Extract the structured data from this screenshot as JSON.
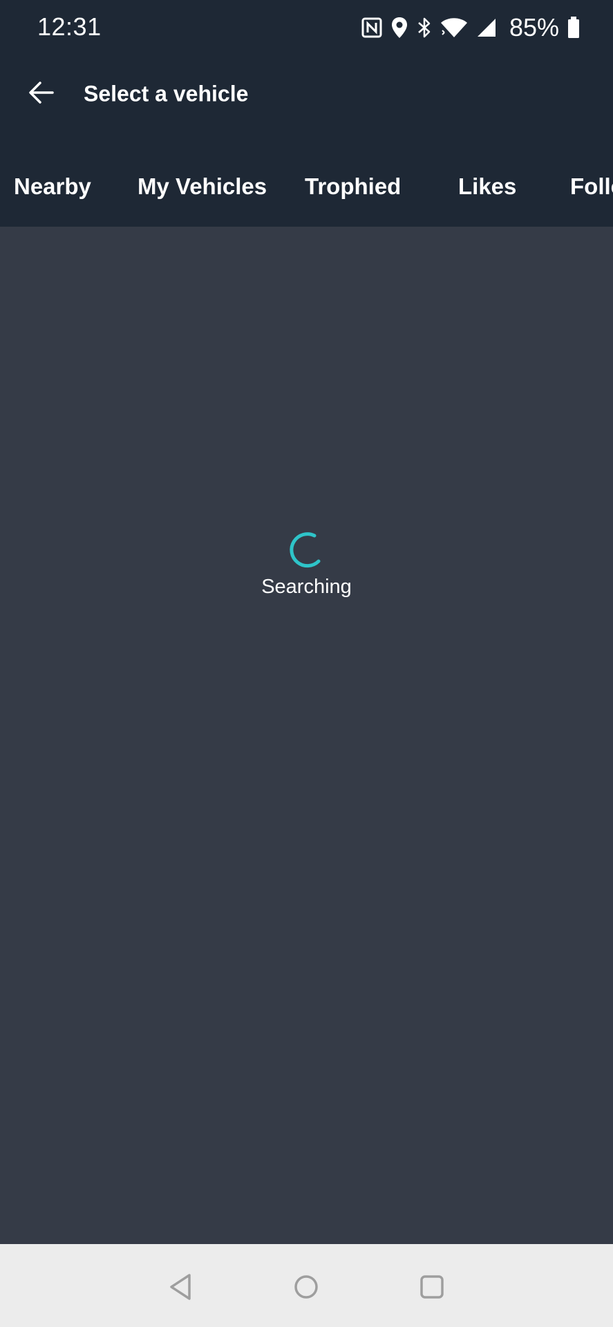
{
  "status_bar": {
    "time": "12:31",
    "battery": "85%",
    "icons": [
      "nfc-icon",
      "location-icon",
      "bluetooth-icon",
      "wifi-icon",
      "signal-icon",
      "battery-icon"
    ]
  },
  "app_bar": {
    "title": "Select a vehicle",
    "back_icon": "arrow-left-icon"
  },
  "tabs": [
    {
      "label": "Nearby"
    },
    {
      "label": "My Vehicles"
    },
    {
      "label": "Trophied"
    },
    {
      "label": "Likes"
    },
    {
      "label": "Following"
    }
  ],
  "content": {
    "loading_text": "Searching",
    "spinner_color": "#2ec4c9"
  },
  "nav_bar": {
    "icons": [
      "nav-back-icon",
      "nav-home-icon",
      "nav-recents-icon"
    ]
  },
  "colors": {
    "header_bg": "#1e2835",
    "content_bg": "#353b47",
    "nav_bg": "#ececec",
    "accent": "#2ec4c9"
  }
}
